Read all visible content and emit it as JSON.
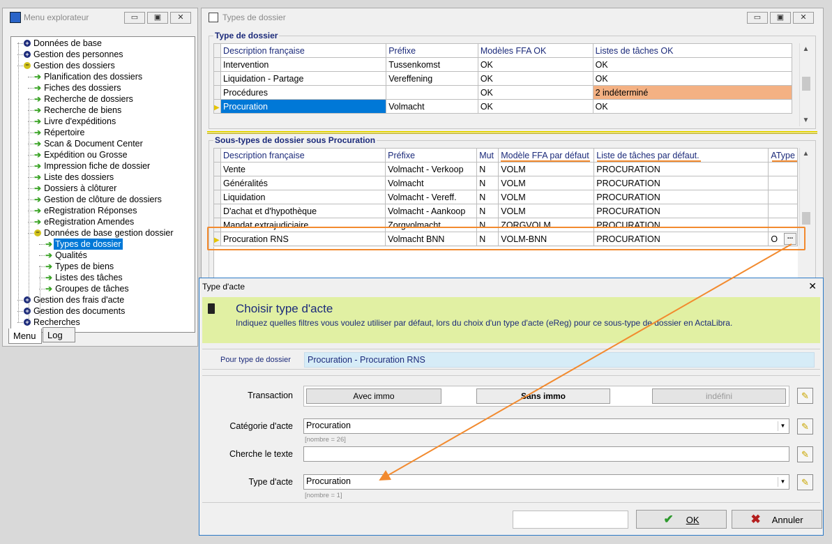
{
  "menu_window": {
    "title": "Menu explorateur",
    "tree": [
      {
        "label": "Données de base",
        "level": 0,
        "icon": "plus"
      },
      {
        "label": "Gestion des personnes",
        "level": 0,
        "icon": "plus"
      },
      {
        "label": "Gestion des dossiers",
        "level": 0,
        "icon": "minus"
      },
      {
        "label": "Planification des dossiers",
        "level": 1,
        "icon": "arrow"
      },
      {
        "label": "Fiches des dossiers",
        "level": 1,
        "icon": "arrow"
      },
      {
        "label": "Recherche de dossiers",
        "level": 1,
        "icon": "arrow"
      },
      {
        "label": "Recherche de biens",
        "level": 1,
        "icon": "arrow"
      },
      {
        "label": "Livre d'expéditions",
        "level": 1,
        "icon": "arrow"
      },
      {
        "label": "Répertoire",
        "level": 1,
        "icon": "arrow"
      },
      {
        "label": "Scan & Document Center",
        "level": 1,
        "icon": "arrow"
      },
      {
        "label": "Expédition ou Grosse",
        "level": 1,
        "icon": "arrow"
      },
      {
        "label": "Impression fiche de dossier",
        "level": 1,
        "icon": "arrow"
      },
      {
        "label": "Liste des dossiers",
        "level": 1,
        "icon": "arrow"
      },
      {
        "label": "Dossiers à clôturer",
        "level": 1,
        "icon": "arrow"
      },
      {
        "label": "Gestion de clôture de dossiers",
        "level": 1,
        "icon": "arrow"
      },
      {
        "label": "eRegistration Réponses",
        "level": 1,
        "icon": "arrow"
      },
      {
        "label": "eRegistration Amendes",
        "level": 1,
        "icon": "arrow"
      },
      {
        "label": "Données de base gestion dossier",
        "level": 1,
        "icon": "minus"
      },
      {
        "label": "Types de dossier",
        "level": 2,
        "icon": "arrow",
        "selected": true
      },
      {
        "label": "Qualités",
        "level": 2,
        "icon": "arrow"
      },
      {
        "label": "Types de biens",
        "level": 2,
        "icon": "arrow"
      },
      {
        "label": "Listes des tâches",
        "level": 2,
        "icon": "arrow"
      },
      {
        "label": "Groupes de tâches",
        "level": 2,
        "icon": "arrow"
      },
      {
        "label": "Gestion des frais d'acte",
        "level": 0,
        "icon": "plus"
      },
      {
        "label": "Gestion des documents",
        "level": 0,
        "icon": "plus"
      },
      {
        "label": "Recherches",
        "level": 0,
        "icon": "plus"
      }
    ],
    "tabs": [
      "Menu",
      "Log"
    ]
  },
  "types_window": {
    "title": "Types de dossier",
    "group1_title": "Type de dossier",
    "grid1_headers": [
      "Description française",
      "Préfixe",
      "Modèles FFA OK",
      "Listes de tâches OK"
    ],
    "grid1_rows": [
      [
        "Intervention",
        "Tussenkomst",
        "OK",
        "OK"
      ],
      [
        "Liquidation - Partage",
        "Vereffening",
        "OK",
        "OK"
      ],
      [
        "Procédures",
        "",
        "OK",
        "2 indéterminé"
      ],
      [
        "Procuration",
        "Volmacht",
        "OK",
        "OK"
      ]
    ],
    "group2_title": "Sous-types de dossier sous Procuration",
    "grid2_headers": [
      "Description française",
      "Préfixe",
      "Mut",
      "Modèle FFA par défaut",
      "Liste de tâches par défaut.",
      "AType"
    ],
    "grid2_rows": [
      [
        "Vente",
        "Volmacht - Verkoop",
        "N",
        "VOLM",
        "PROCURATION",
        ""
      ],
      [
        "Généralités",
        "Volmacht",
        "N",
        "VOLM",
        "PROCURATION",
        ""
      ],
      [
        "Liquidation",
        "Volmacht - Vereff.",
        "N",
        "VOLM",
        "PROCURATION",
        ""
      ],
      [
        "D'achat et d'hypothèque",
        "Volmacht - Aankoop",
        "N",
        "VOLM",
        "PROCURATION",
        ""
      ],
      [
        "Mandat extrajudiciaire",
        "Zorgvolmacht",
        "N",
        "ZORGVOLM",
        "PROCURATION",
        ""
      ],
      [
        "Procuration RNS",
        "Volmacht BNN",
        "N",
        "VOLM-BNN",
        "PROCURATION",
        "O"
      ]
    ],
    "ellipsis": "...",
    "highlight_color": "#f4b183"
  },
  "dialog": {
    "title": "Type d'acte",
    "close": "✕",
    "heading": "Choisir type d'acte",
    "description": "Indiquez quelles filtres vous voulez utiliser par défaut, lors du choix d'un type d'acte (eReg) pour ce sous-type de dossier en ActaLibra.",
    "for_label": "Pour type de dossier",
    "for_value": "Procuration - Procuration RNS",
    "transaction_label": "Transaction",
    "transaction_options": [
      "Avec immo",
      "Sans immo",
      "indéfini"
    ],
    "categorie_label": "Catégorie d'acte",
    "categorie_value": "Procuration",
    "categorie_count": "[nombre = 26]",
    "cherche_label": "Cherche le texte",
    "cherche_value": "",
    "type_label": "Type d'acte",
    "type_value": "Procuration",
    "type_count": "[nombre = 1]",
    "ok_label": "OK",
    "cancel_label": "Annuler"
  },
  "annotation_color": "#f28a2e"
}
